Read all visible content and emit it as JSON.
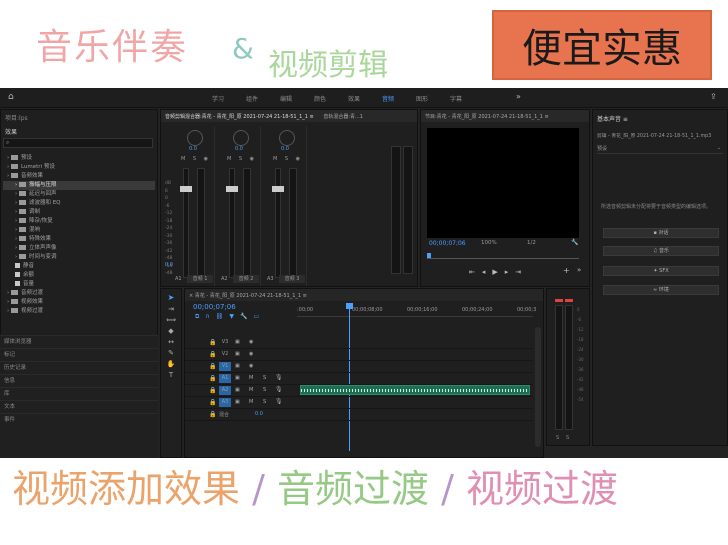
{
  "banner": {
    "title": "音乐伴奏",
    "amp": "&",
    "subtitle": "视频剪辑",
    "promo": "便宜实惠"
  },
  "workspace_tabs": [
    "学习",
    "组件",
    "编辑",
    "颜色",
    "效果",
    "音频",
    "图形",
    "字幕"
  ],
  "workspace_active": "音频",
  "left": {
    "project_label": "项目:lps",
    "effects_label": "效果",
    "tree": [
      {
        "label": "预设",
        "depth": 1
      },
      {
        "label": "Lumetri 预设",
        "depth": 1
      },
      {
        "label": "音频效果",
        "depth": 1
      },
      {
        "label": "振幅与压限",
        "depth": 2,
        "selected": true
      },
      {
        "label": "延迟与回声",
        "depth": 2
      },
      {
        "label": "滤波器和 EQ",
        "depth": 2
      },
      {
        "label": "调制",
        "depth": 2
      },
      {
        "label": "降杂/恢复",
        "depth": 2
      },
      {
        "label": "混响",
        "depth": 2
      },
      {
        "label": "特殊效果",
        "depth": 2
      },
      {
        "label": "立体声声像",
        "depth": 2
      },
      {
        "label": "时间与变调",
        "depth": 2
      },
      {
        "label": "静音",
        "depth": 2,
        "item": true
      },
      {
        "label": "余额",
        "depth": 2,
        "item": true
      },
      {
        "label": "音量",
        "depth": 2,
        "item": true
      },
      {
        "label": "音频过渡",
        "depth": 1
      },
      {
        "label": "视频效果",
        "depth": 1
      },
      {
        "label": "视频过渡",
        "depth": 1
      }
    ],
    "bottom_panels": [
      "媒体浏览器",
      "标记",
      "历史记录",
      "信息",
      "库",
      "文本",
      "事件"
    ]
  },
  "mixer": {
    "tab1": "音频剪辑混合器:青花 - 青花_阳_原 2021-07-24 21-18-51_1_1 ≡",
    "tab2": "音轨混合器:青...1",
    "channels": [
      {
        "id": "A1",
        "name": "音频 1",
        "vol": "0.0"
      },
      {
        "id": "A2",
        "name": "音频 2",
        "vol": "0.0"
      },
      {
        "id": "A3",
        "name": "音频 3",
        "vol": "0.0"
      }
    ],
    "master_val": "0.0",
    "scale": [
      "dB",
      "6",
      "0",
      "-6",
      "-12",
      "-18",
      "-24",
      "-30",
      "-36",
      "-42",
      "-48",
      "-54",
      "-dB"
    ]
  },
  "program": {
    "tab": "节目:青花 - 青花_阳_原 2021-07-24 21-18-51_1_1 ≡",
    "timecode": "00;00;07;06",
    "zoom": "100%",
    "fraction": "1/2"
  },
  "timeline": {
    "tab": "青花 - 青花_阳_原 2021-07-24 21-18-51_1_1 ≡",
    "timecode": "00;00;07;06",
    "ruler": [
      ":00;00",
      "00;00;08;00",
      "00;00;16;00",
      "00;00;24;00",
      "00;00;3"
    ],
    "video_tracks": [
      "V3",
      "V2",
      "V1"
    ],
    "audio_tracks": [
      "A1",
      "A2",
      "A3"
    ],
    "master": "混合",
    "master_val": "0.0"
  },
  "essential_sound": {
    "title": "基本声音 ≡",
    "clip": "剪辑 - 青花_阳_原 2021-07-24 21-18-51_1_1.mp3",
    "preset_label": "预设",
    "hint": "所选音频剪辑未分配将要于音频类型的编辑选项。",
    "buttons": [
      "对话",
      "音乐",
      "SFX",
      "环境"
    ]
  },
  "meter_labels": [
    "S",
    "S"
  ],
  "bottom_text": {
    "a": "视频添加效果",
    "s1": " / ",
    "b": "音频过渡",
    "s2": " / ",
    "c": "视频过渡"
  }
}
